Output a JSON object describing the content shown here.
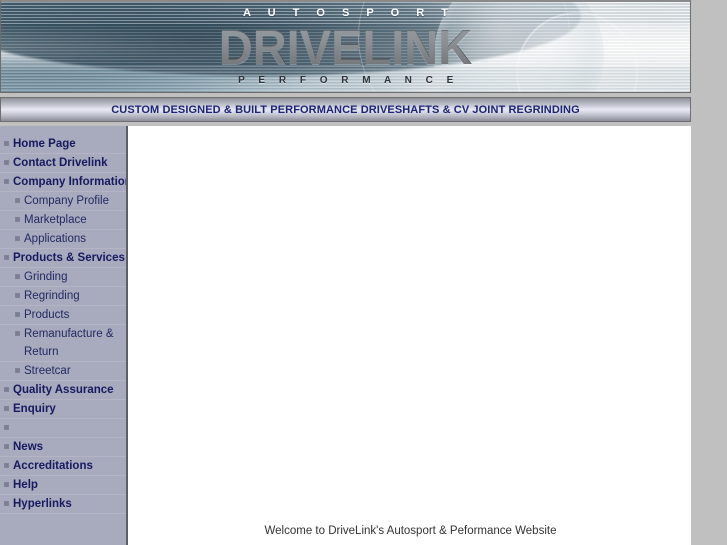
{
  "banner": {
    "kicker": "A U T O S P O R T",
    "wordmark": "DRIVELINK",
    "subline": "P E R F O R M A N C E",
    "colors": {
      "wordmark_grey": "#4a4f54",
      "kicker_white": "#ffffff",
      "subline_dark": "#2e3338"
    }
  },
  "tagline": {
    "text": "CUSTOM DESIGNED & BUILT PERFORMANCE DRIVESHAFTS & CV JOINT REGRINDING",
    "color": "#1d2474"
  },
  "sidebar": {
    "background": "#a8aabd",
    "link_color": "#161a5e",
    "items": [
      {
        "label": "Home Page",
        "level": 1
      },
      {
        "label": "Contact Drivelink",
        "level": 1
      },
      {
        "label": "Company Information",
        "level": 1
      },
      {
        "label": "Company Profile",
        "level": 2
      },
      {
        "label": "Marketplace",
        "level": 2
      },
      {
        "label": "Applications",
        "level": 2
      },
      {
        "label": "Products & Services",
        "level": 1
      },
      {
        "label": "Grinding",
        "level": 2
      },
      {
        "label": "Regrinding",
        "level": 2
      },
      {
        "label": "Products",
        "level": 2
      },
      {
        "label": "Remanufacture & Return",
        "level": 2
      },
      {
        "label": "Streetcar",
        "level": 2
      },
      {
        "label": "Quality Assurance",
        "level": 1
      },
      {
        "label": "Enquiry",
        "level": 1
      },
      {
        "label": "",
        "level": 1
      },
      {
        "label": "News",
        "level": 1
      },
      {
        "label": "Accreditations",
        "level": 1
      },
      {
        "label": "Help",
        "level": 1
      },
      {
        "label": "Hyperlinks",
        "level": 1
      }
    ]
  },
  "content": {
    "welcome": "Welcome to DriveLink's Autosport & Peformance Website"
  },
  "page": {
    "background": "#c0c0c0",
    "content_background": "#ffffff"
  }
}
